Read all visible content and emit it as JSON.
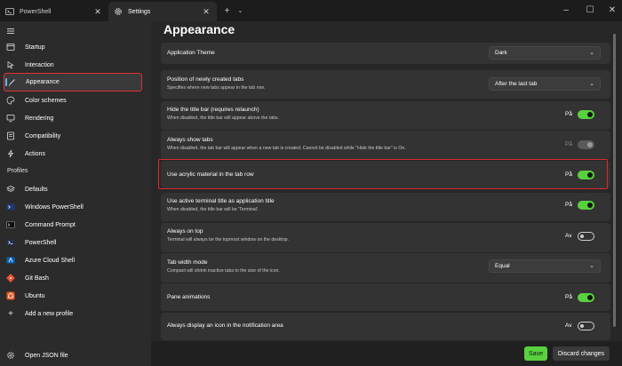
{
  "tabs": [
    {
      "label": "PowerShell",
      "icon": "powershell-icon"
    },
    {
      "label": "Settings",
      "icon": "gear-icon"
    }
  ],
  "window_controls": {
    "minimize": "–",
    "maximize": "☐",
    "close": "✕"
  },
  "sidebar": {
    "items": [
      {
        "label": "Startup"
      },
      {
        "label": "Interaction"
      },
      {
        "label": "Appearance"
      },
      {
        "label": "Color schemes"
      },
      {
        "label": "Rendering"
      },
      {
        "label": "Compatibility"
      },
      {
        "label": "Actions"
      }
    ],
    "profiles_header": "Profiles",
    "profiles": [
      {
        "label": "Defaults"
      },
      {
        "label": "Windows PowerShell"
      },
      {
        "label": "Command Prompt"
      },
      {
        "label": "PowerShell"
      },
      {
        "label": "Azure Cloud Shell"
      },
      {
        "label": "Git Bash"
      },
      {
        "label": "Ubuntu"
      },
      {
        "label": "Add a new profile"
      }
    ],
    "open_json": "Open JSON file"
  },
  "main": {
    "title": "Appearance",
    "settings": [
      {
        "title": "Application Theme",
        "value": "Dark"
      },
      {
        "title": "Position of newly created tabs",
        "desc": "Specifies where new tabs appear in the tab row.",
        "value": "After the last tab"
      },
      {
        "title": "Hide the title bar (requires relaunch)",
        "desc": "When disabled, the title bar will appear above the tabs.",
        "state": "På"
      },
      {
        "title": "Always show tabs",
        "desc": "When disabled, the tab bar will appear when a new tab is created. Cannot be disabled while \"Hide the title bar\" is On.",
        "state": "På"
      },
      {
        "title": "Use acrylic material in the tab row",
        "state": "På"
      },
      {
        "title": "Use active terminal title as application title",
        "desc": "When disabled, the title bar will be 'Terminal'.",
        "state": "På"
      },
      {
        "title": "Always on top",
        "desc": "Terminal will always be the topmost window on the desktop.",
        "state": "Av"
      },
      {
        "title": "Tab width mode",
        "desc": "Compact will shrink inactive tabs to the size of the icon.",
        "value": "Equal"
      },
      {
        "title": "Pane animations",
        "state": "På"
      },
      {
        "title": "Always display an icon in the notification area",
        "state": "Av"
      }
    ]
  },
  "footer": {
    "save": "Save",
    "discard": "Discard changes"
  },
  "colors": {
    "accent": "#59d13f",
    "selection": "#4cc2ff",
    "highlight": "#d92b2b"
  }
}
